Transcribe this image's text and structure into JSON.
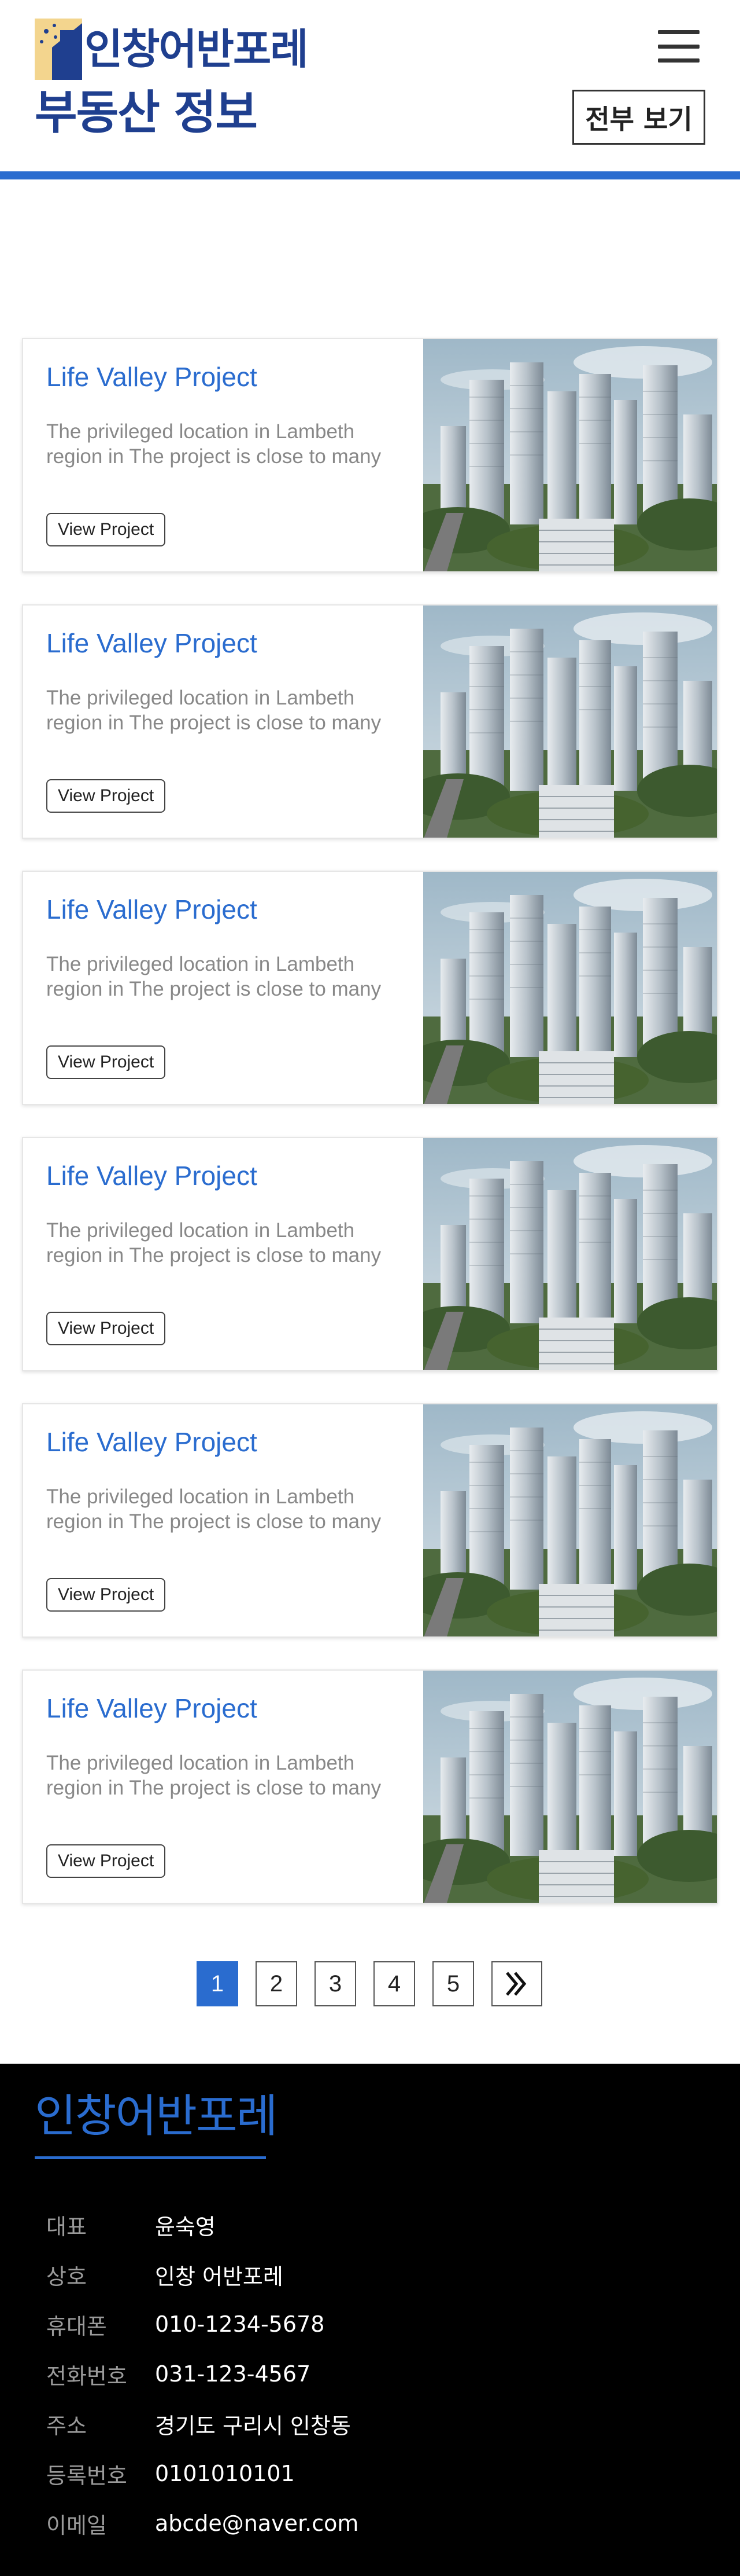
{
  "header": {
    "logo_text": "인창어반포레"
  },
  "section": {
    "title": "부동산 정보",
    "view_all_label": "전부 보기"
  },
  "cards": [
    {
      "title": "Life Valley Project",
      "description": "The privileged location in Lambeth region in The project is close to many",
      "button_label": "View Project"
    },
    {
      "title": "Life Valley Project",
      "description": "The privileged location in Lambeth region in The project is close to many",
      "button_label": "View Project"
    },
    {
      "title": "Life Valley Project",
      "description": "The privileged location in Lambeth region in The project is close to many",
      "button_label": "View Project"
    },
    {
      "title": "Life Valley Project",
      "description": "The privileged location in Lambeth region in The project is close to many",
      "button_label": "View Project"
    },
    {
      "title": "Life Valley Project",
      "description": "The privileged location in Lambeth region in The project is close to many",
      "button_label": "View Project"
    },
    {
      "title": "Life Valley Project",
      "description": "The privileged location in Lambeth region in The project is close to many",
      "button_label": "View Project"
    }
  ],
  "pagination": {
    "pages": [
      "1",
      "2",
      "3",
      "4",
      "5"
    ],
    "current": "1",
    "next_icon": "double-chevron-right-icon"
  },
  "footer": {
    "brand": "인창어반포레",
    "info": [
      {
        "label": "대표",
        "value": "윤숙영"
      },
      {
        "label": "상호",
        "value": "인창 어반포레"
      },
      {
        "label": "휴대폰",
        "value": "010-1234-5678"
      },
      {
        "label": "전화번호",
        "value": "031-123-4567"
      },
      {
        "label": "주소",
        "value": "경기도 구리시 인창동"
      },
      {
        "label": "등록번호",
        "value": "0101010101"
      },
      {
        "label": "이메일",
        "value": "abcde@naver.com"
      }
    ]
  },
  "colors": {
    "brand_blue": "#1f3f8f",
    "accent_blue": "#2a6ccf",
    "footer_bg": "#000000"
  }
}
